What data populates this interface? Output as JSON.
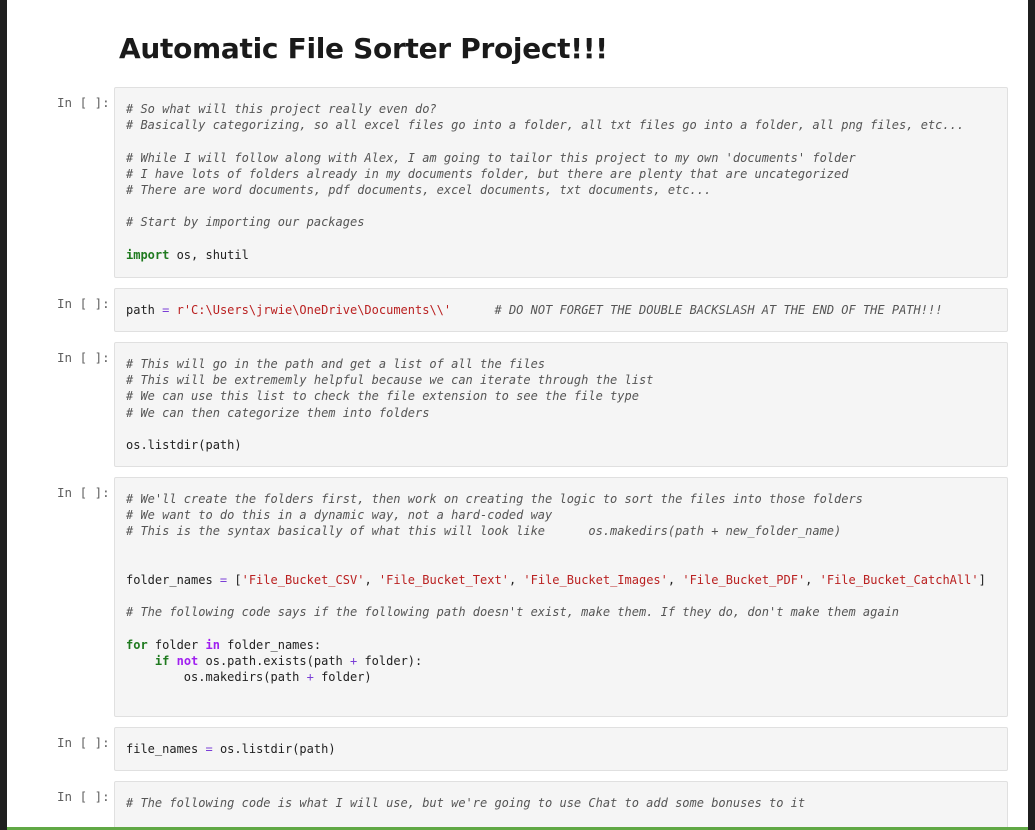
{
  "notebook": {
    "title": "Automatic File Sorter Project!!!"
  },
  "prompt_label": "In [ ]:",
  "cells": [
    {
      "lines": [
        {
          "type": "comment",
          "text": "# So what will this project really even do?"
        },
        {
          "type": "comment",
          "text": "# Basically categorizing, so all excel files go into a folder, all txt files go into a folder, all png files, etc..."
        },
        {
          "type": "blank"
        },
        {
          "type": "comment",
          "text": "# While I will follow along with Alex, I am going to tailor this project to my own 'documents' folder"
        },
        {
          "type": "comment",
          "text": "# I have lots of folders already in my documents folder, but there are plenty that are uncategorized"
        },
        {
          "type": "comment",
          "text": "# There are word documents, pdf documents, excel documents, txt documents, etc..."
        },
        {
          "type": "blank"
        },
        {
          "type": "comment",
          "text": "# Start by importing our packages"
        },
        {
          "type": "blank"
        },
        {
          "type": "code",
          "tokens": [
            {
              "cls": "k",
              "text": "import"
            },
            {
              "cls": "p",
              "text": " os, shutil"
            }
          ]
        }
      ]
    },
    {
      "lines": [
        {
          "type": "code",
          "tokens": [
            {
              "cls": "p",
              "text": "path "
            },
            {
              "cls": "o",
              "text": "="
            },
            {
              "cls": "p",
              "text": " "
            },
            {
              "cls": "s",
              "text": "r'C:\\Users\\jrwie\\OneDrive\\Documents\\\\'"
            },
            {
              "cls": "p",
              "text": "      "
            },
            {
              "cls": "c",
              "text": "# DO NOT FORGET THE DOUBLE BACKSLASH AT THE END OF THE PATH!!!"
            }
          ]
        }
      ]
    },
    {
      "lines": [
        {
          "type": "comment",
          "text": "# This will go in the path and get a list of all the files"
        },
        {
          "type": "comment",
          "text": "# This will be extrememly helpful because we can iterate through the list"
        },
        {
          "type": "comment",
          "text": "# We can use this list to check the file extension to see the file type"
        },
        {
          "type": "comment",
          "text": "# We can then categorize them into folders"
        },
        {
          "type": "blank"
        },
        {
          "type": "code",
          "tokens": [
            {
              "cls": "p",
              "text": "os.listdir(path)"
            }
          ]
        }
      ]
    },
    {
      "lines": [
        {
          "type": "comment",
          "text": "# We'll create the folders first, then work on creating the logic to sort the files into those folders"
        },
        {
          "type": "comment",
          "text": "# We want to do this in a dynamic way, not a hard-coded way"
        },
        {
          "type": "comment",
          "text": "# This is the syntax basically of what this will look like      os.makedirs(path + new_folder_name)"
        },
        {
          "type": "blank"
        },
        {
          "type": "blank"
        },
        {
          "type": "code",
          "tokens": [
            {
              "cls": "p",
              "text": "folder_names "
            },
            {
              "cls": "o",
              "text": "="
            },
            {
              "cls": "p",
              "text": " ["
            },
            {
              "cls": "s",
              "text": "'File_Bucket_CSV'"
            },
            {
              "cls": "p",
              "text": ", "
            },
            {
              "cls": "s",
              "text": "'File_Bucket_Text'"
            },
            {
              "cls": "p",
              "text": ", "
            },
            {
              "cls": "s",
              "text": "'File_Bucket_Images'"
            },
            {
              "cls": "p",
              "text": ", "
            },
            {
              "cls": "s",
              "text": "'File_Bucket_PDF'"
            },
            {
              "cls": "p",
              "text": ", "
            },
            {
              "cls": "s",
              "text": "'File_Bucket_CatchAll'"
            },
            {
              "cls": "p",
              "text": "]"
            }
          ]
        },
        {
          "type": "blank"
        },
        {
          "type": "comment",
          "text": "# The following code says if the following path doesn't exist, make them. If they do, don't make them again"
        },
        {
          "type": "blank"
        },
        {
          "type": "code",
          "tokens": [
            {
              "cls": "k",
              "text": "for"
            },
            {
              "cls": "p",
              "text": " folder "
            },
            {
              "cls": "ow",
              "text": "in"
            },
            {
              "cls": "p",
              "text": " folder_names:"
            }
          ]
        },
        {
          "type": "code",
          "tokens": [
            {
              "cls": "p",
              "text": "    "
            },
            {
              "cls": "k",
              "text": "if"
            },
            {
              "cls": "p",
              "text": " "
            },
            {
              "cls": "ow",
              "text": "not"
            },
            {
              "cls": "p",
              "text": " os.path.exists(path "
            },
            {
              "cls": "o",
              "text": "+"
            },
            {
              "cls": "p",
              "text": " folder):"
            }
          ]
        },
        {
          "type": "code",
          "tokens": [
            {
              "cls": "p",
              "text": "        os.makedirs(path "
            },
            {
              "cls": "o",
              "text": "+"
            },
            {
              "cls": "p",
              "text": " folder)"
            }
          ]
        },
        {
          "type": "blank"
        },
        {
          "type": "blank"
        }
      ]
    },
    {
      "lines": [
        {
          "type": "code",
          "tokens": [
            {
              "cls": "p",
              "text": "file_names "
            },
            {
              "cls": "o",
              "text": "="
            },
            {
              "cls": "p",
              "text": " os.listdir(path)"
            }
          ]
        }
      ]
    },
    {
      "lines": [
        {
          "type": "comment",
          "text": "# The following code is what I will use, but we're going to use Chat to add some bonuses to it"
        }
      ]
    }
  ]
}
